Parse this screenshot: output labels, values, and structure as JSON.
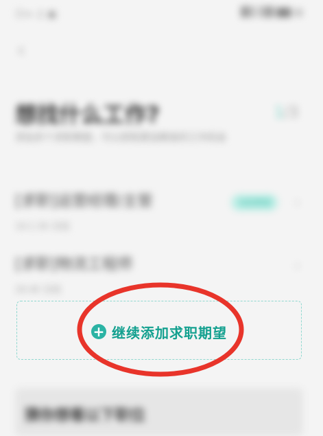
{
  "status_bar": {
    "left_text": "ⓐ∞ ♫ ▣",
    "right_text": "▓▒ ▒▓ ▇▇ ▤"
  },
  "header": {
    "back_symbol": "‹"
  },
  "page": {
    "title": "想找什么工作?",
    "subtitle": "添加多个求职期望，可以获取更加精准的工作机会",
    "count_current": "1",
    "count_sep": "/3"
  },
  "jobs": [
    {
      "title": "[求职]运营经理/主管",
      "sub": "1K-1.5K 日结",
      "tag": "当前期望"
    },
    {
      "title": "[求职]物流工程师",
      "sub": "2K-4K 日结"
    }
  ],
  "add_button": {
    "label": "继续添加求职期望",
    "icon": "plus-icon"
  },
  "bottom": {
    "label": "猜你想看以下职位"
  },
  "colors": {
    "accent": "#13a08f",
    "dashed_border": "#8fd8cf",
    "annotation": "#e8342a"
  }
}
